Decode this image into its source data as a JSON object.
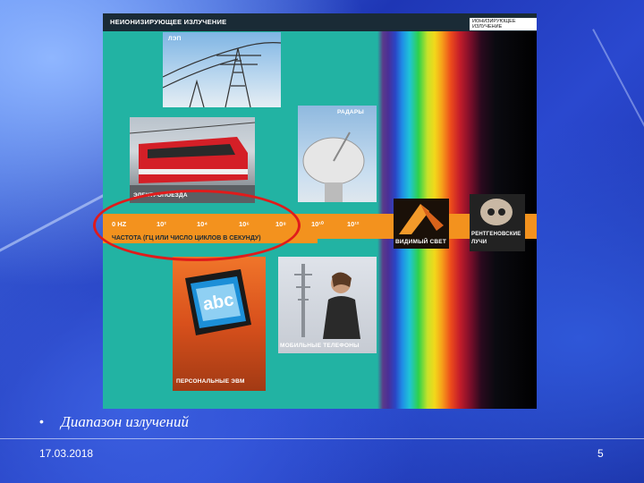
{
  "figure": {
    "header_title": "НЕИОНИЗИРУЮЩЕЕ ИЗЛУЧЕНИЕ",
    "ionizing_label": "ИОНИЗИРУЮЩЕЕ ИЗЛУЧЕНИЕ",
    "captions": {
      "power_lines": "ЛЭП",
      "trains": "ЭЛЕКТРОПОЕЗДА",
      "radars": "РАДАРЫ",
      "visible_light": "ВИДИМЫЙ СВЕТ",
      "xray_line1": "РЕНТГЕНОВСКИЕ",
      "xray_line2": "ЛУЧИ",
      "computers": "ПЕРСОНАЛЬНЫЕ ЭВМ",
      "mobile": "МОБИЛЬНЫЕ ТЕЛЕФОНЫ"
    },
    "frequencies": [
      "0 HZ",
      "10²",
      "10⁴",
      "10⁶",
      "10⁸",
      "10¹⁰",
      "10¹²"
    ],
    "frequency_caption": "ЧАСТОТА (ГЦ ИЛИ ЧИСЛО ЦИКЛОВ В СЕКУНДУ)",
    "screen_text": "abc",
    "colors": {
      "background": "#22b3a3",
      "band": "#f3921e",
      "highlight": "#e01b1b"
    }
  },
  "slide": {
    "bullet": "Диапазон излучений",
    "date": "17.03.2018",
    "page_number": "5"
  }
}
